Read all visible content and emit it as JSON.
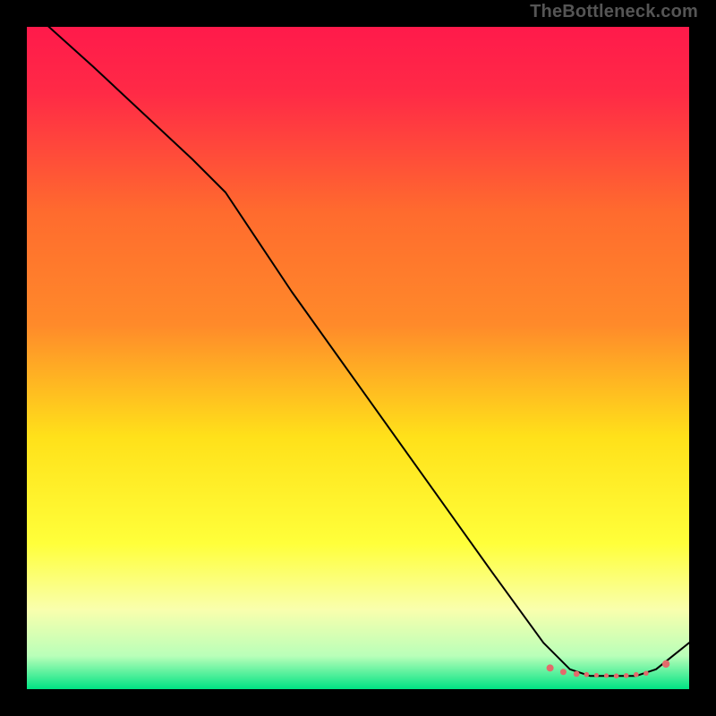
{
  "watermark": "TheBottleneck.com",
  "chart_data": {
    "type": "line",
    "title": "",
    "xlabel": "",
    "ylabel": "",
    "xlim": [
      0,
      100
    ],
    "ylim": [
      0,
      100
    ],
    "grid": false,
    "legend": null,
    "background_gradient": {
      "top": "#ff1a4b",
      "upper_mid": "#ff8a2a",
      "mid": "#ffe11a",
      "lower_mid": "#f9ffad",
      "bottom": "#00e383"
    },
    "series": [
      {
        "name": "curve",
        "stroke": "#000000",
        "stroke_width": 2,
        "x": [
          0,
          10,
          25,
          30,
          40,
          50,
          60,
          70,
          78,
          82,
          85,
          88,
          90,
          92,
          95,
          100
        ],
        "y": [
          103,
          94,
          80,
          75,
          60,
          46,
          32,
          18,
          7,
          3,
          2,
          2,
          2,
          2,
          3,
          7
        ]
      }
    ],
    "markers": [
      {
        "x": 79,
        "y": 3.2,
        "r": 4.0,
        "fill": "#e26b6b"
      },
      {
        "x": 81,
        "y": 2.6,
        "r": 3.5,
        "fill": "#e26b6b"
      },
      {
        "x": 83,
        "y": 2.3,
        "r": 3.3,
        "fill": "#e26b6b"
      },
      {
        "x": 84.5,
        "y": 2.2,
        "r": 2.8,
        "fill": "#e26b6b"
      },
      {
        "x": 86,
        "y": 2.1,
        "r": 2.6,
        "fill": "#e26b6b"
      },
      {
        "x": 87.5,
        "y": 2.05,
        "r": 2.6,
        "fill": "#e26b6b"
      },
      {
        "x": 89,
        "y": 2.0,
        "r": 2.8,
        "fill": "#e26b6b"
      },
      {
        "x": 90.5,
        "y": 2.05,
        "r": 2.8,
        "fill": "#e26b6b"
      },
      {
        "x": 92,
        "y": 2.2,
        "r": 2.8,
        "fill": "#e26b6b"
      },
      {
        "x": 93.5,
        "y": 2.4,
        "r": 2.8,
        "fill": "#e26b6b"
      },
      {
        "x": 96.5,
        "y": 3.8,
        "r": 4.2,
        "fill": "#e26b6b"
      }
    ]
  }
}
